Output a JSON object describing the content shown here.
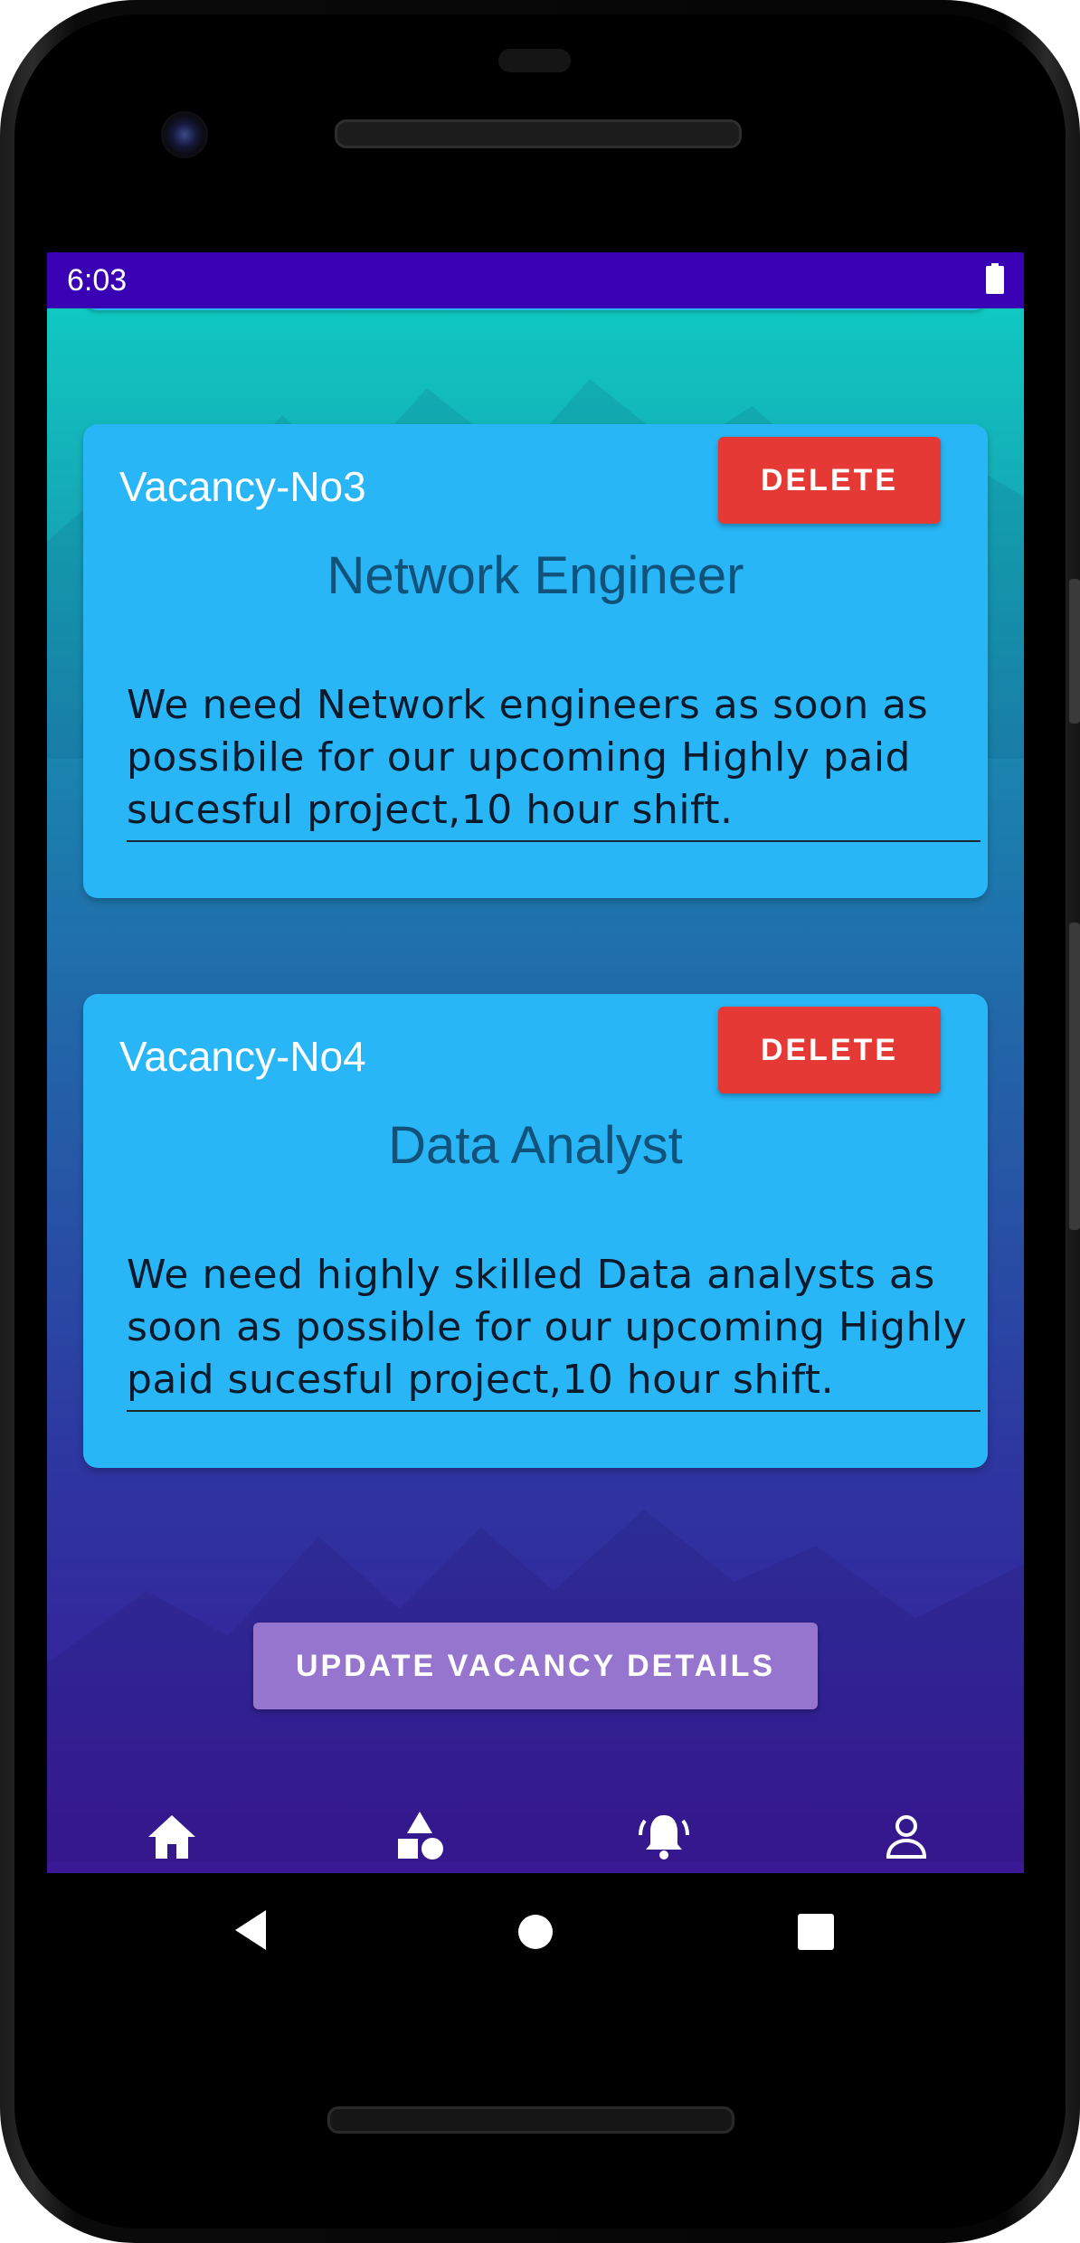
{
  "statusbar": {
    "time": "6:03",
    "battery_icon": "battery-full-icon"
  },
  "vacancies": [
    {
      "number": "Vacancy-No3",
      "delete_label": "DELETE",
      "title": "Network Engineer",
      "description": "We need Network engineers as soon as possibile for our upcoming Highly paid sucesful project,10 hour shift."
    },
    {
      "number": "Vacancy-No4",
      "delete_label": "DELETE",
      "title": "Data Analyst",
      "description": "We need highly skilled Data analysts as soon as possible for our upcoming Highly paid sucesful project,10 hour shift."
    }
  ],
  "update_button": {
    "label": "UPDATE VACANCY DETAILS"
  },
  "bottom_nav": {
    "items": [
      {
        "icon": "home-icon"
      },
      {
        "icon": "shapes-icon"
      },
      {
        "icon": "notification-bell-icon"
      },
      {
        "icon": "profile-icon"
      }
    ]
  },
  "system_nav": {
    "items": [
      {
        "icon": "back-icon"
      },
      {
        "icon": "home-circle-icon"
      },
      {
        "icon": "recents-icon"
      }
    ]
  },
  "colors": {
    "statusbar": "#3a00b3",
    "card": "#29b6f6",
    "delete_button": "#e53935",
    "update_button": "#9575cd",
    "title_text": "#11527a"
  }
}
